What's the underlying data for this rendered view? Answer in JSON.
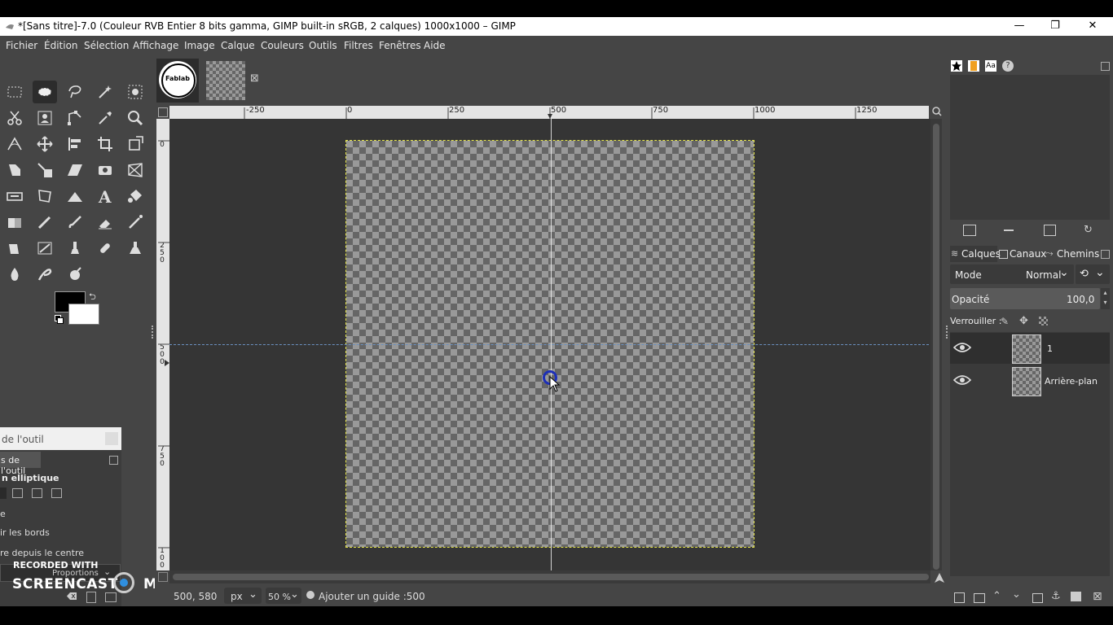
{
  "window": {
    "title": "*[Sans titre]-7.0 (Couleur RVB Entier 8 bits gamma, GIMP built-in sRGB, 2 calques) 1000x1000 – GIMP",
    "minimize": "—",
    "maximize": "❐",
    "close": "✕"
  },
  "menu": [
    "Fichier",
    "Édition",
    "Sélection",
    "Affichage",
    "Image",
    "Calque",
    "Couleurs",
    "Outils",
    "Filtres",
    "Fenêtres",
    "Aide"
  ],
  "image_tabs": [
    {
      "name": "Fablab",
      "close": "⊠"
    }
  ],
  "ruler_h_labels": [
    "-250",
    "0",
    "250",
    "500",
    "750",
    "1000",
    "1250"
  ],
  "ruler_v_labels": [
    "0",
    "2\n5\n0",
    "5\n0\n0",
    "7\n5\n0",
    "1\n0\n0"
  ],
  "tool_options": {
    "title": "de l'outil",
    "tab": "s de l'outil",
    "tool_name": "n elliptique",
    "option_e": "e",
    "option_borders": "ir les bords",
    "option_center": "re depuis le centre",
    "fixed": "Proportions"
  },
  "watermark": {
    "line1": "RECORDED WITH",
    "brand_left": "SCREENCAST",
    "brand_right": "MATIC"
  },
  "status": {
    "coords": "500, 580",
    "unit": "px",
    "zoom": "50 %",
    "message": "Ajouter un guide :500"
  },
  "dock": {
    "tabs": {
      "layers": "Calques",
      "channels": "Canaux",
      "paths": "Chemins"
    },
    "mode_label": "Mode",
    "mode_value": "Normal",
    "opacity_label": "Opacité",
    "opacity_value": "100,0",
    "lock_label": "Verrouiller :",
    "layers": [
      {
        "name": "1"
      },
      {
        "name": "Arrière-plan"
      }
    ]
  },
  "colors": {
    "fg": "#000000",
    "bg": "#ffffff",
    "accent": "#5080c0"
  }
}
